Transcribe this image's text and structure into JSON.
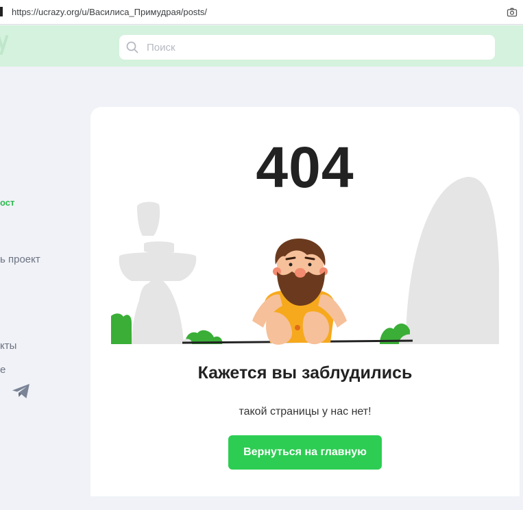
{
  "browser": {
    "url": "https://ucrazy.org/u/Василиса_Примудрая/posts/",
    "camera_icon": "camera-icon"
  },
  "header": {
    "logo_fragment": "y",
    "search": {
      "placeholder": "Поиск",
      "value": ""
    },
    "background_color": "#d4f2dd"
  },
  "sidebar": {
    "items": [
      {
        "label": "ост",
        "accent": true
      },
      {
        "label": "ь проект"
      },
      {
        "label": "кты"
      },
      {
        "label": "е"
      }
    ],
    "telegram_icon": "telegram-icon"
  },
  "error_page": {
    "code": "404",
    "title": "Кажется вы заблудились",
    "subtitle": "такой страницы у нас нет!",
    "button_label": "Вернуться на главную",
    "button_color": "#2dcd53"
  }
}
